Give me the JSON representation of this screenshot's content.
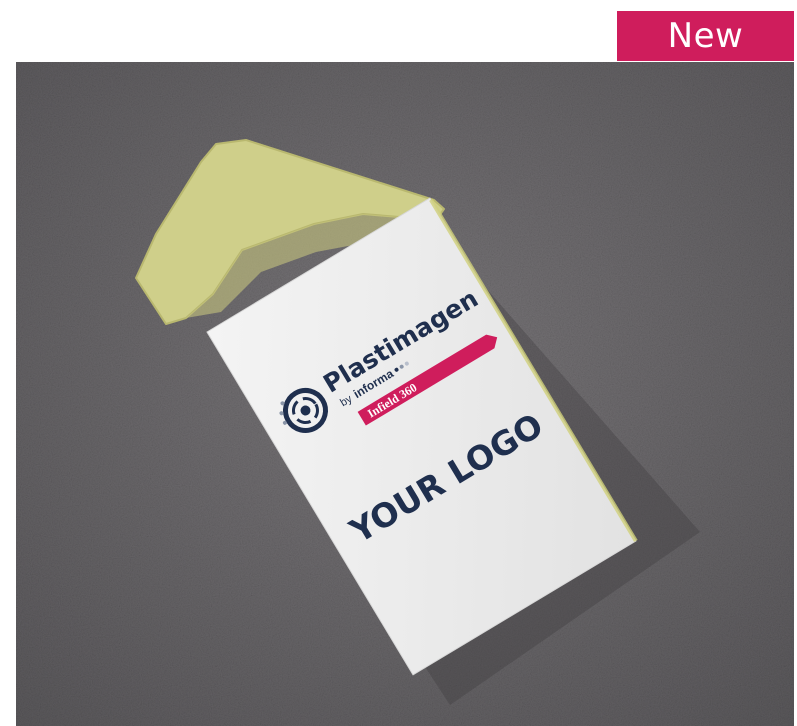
{
  "badge": {
    "label": "New",
    "color": "#cf1d5c"
  },
  "photo": {
    "subject": "floor-marker-photo",
    "sign": {
      "brand_name": "Plastimagen",
      "brand_sub_prefix": "by",
      "brand_sub_name": "informa",
      "banner_label": "Infield 360",
      "placeholder_label": "YOUR LOGO"
    },
    "colors": {
      "carpet": "#6a6769",
      "arrow": "#cfcf8a",
      "sign": "#ececec",
      "navy": "#1f2f4e",
      "banner": "#cf1d5c"
    }
  }
}
